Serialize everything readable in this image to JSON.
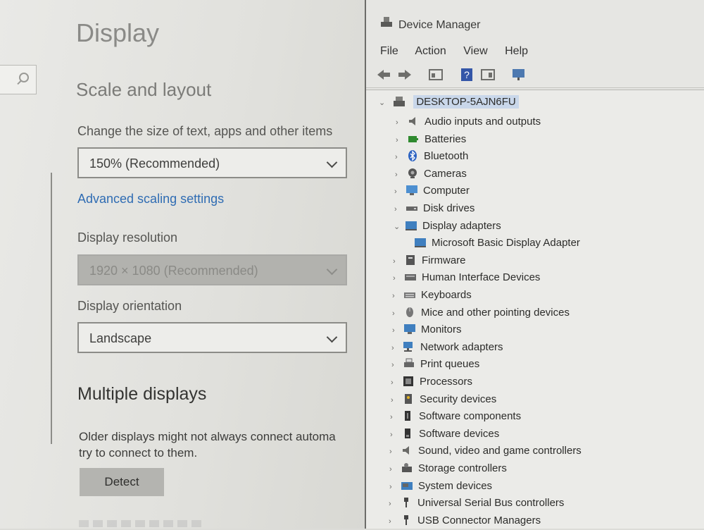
{
  "settings": {
    "title": "Display",
    "section_scale": "Scale and layout",
    "scale_label": "Change the size of text, apps and other items",
    "scale_value": "150% (Recommended)",
    "advanced_link": "Advanced scaling settings",
    "resolution_label": "Display resolution",
    "resolution_value": "1920 × 1080 (Recommended)",
    "orientation_label": "Display orientation",
    "orientation_value": "Landscape",
    "section_multiple": "Multiple displays",
    "multiple_text_1": "Older displays might not always connect automa",
    "multiple_text_2": "try to connect to them.",
    "detect_button": "Detect"
  },
  "device_manager": {
    "title": "Device Manager",
    "menu": [
      "File",
      "Action",
      "View",
      "Help"
    ],
    "root": "DESKTOP-5AJN6FU",
    "nodes": [
      {
        "label": "Audio inputs and outputs",
        "icon": "speaker-icon",
        "expanded": false
      },
      {
        "label": "Batteries",
        "icon": "battery-icon",
        "expanded": false
      },
      {
        "label": "Bluetooth",
        "icon": "bluetooth-icon",
        "expanded": false
      },
      {
        "label": "Cameras",
        "icon": "camera-icon",
        "expanded": false
      },
      {
        "label": "Computer",
        "icon": "computer-icon",
        "expanded": false
      },
      {
        "label": "Disk drives",
        "icon": "disk-icon",
        "expanded": false
      },
      {
        "label": "Display adapters",
        "icon": "display-adapter-icon",
        "expanded": true
      },
      {
        "label": "Microsoft Basic Display Adapter",
        "icon": "display-adapter-icon",
        "child": true
      },
      {
        "label": "Firmware",
        "icon": "firmware-icon",
        "expanded": false
      },
      {
        "label": "Human Interface Devices",
        "icon": "hid-icon",
        "expanded": false
      },
      {
        "label": "Keyboards",
        "icon": "keyboard-icon",
        "expanded": false
      },
      {
        "label": "Mice and other pointing devices",
        "icon": "mouse-icon",
        "expanded": false
      },
      {
        "label": "Monitors",
        "icon": "monitor-icon",
        "expanded": false
      },
      {
        "label": "Network adapters",
        "icon": "network-icon",
        "expanded": false
      },
      {
        "label": "Print queues",
        "icon": "printer-icon",
        "expanded": false
      },
      {
        "label": "Processors",
        "icon": "processor-icon",
        "expanded": false
      },
      {
        "label": "Security devices",
        "icon": "security-icon",
        "expanded": false
      },
      {
        "label": "Software components",
        "icon": "software-component-icon",
        "expanded": false
      },
      {
        "label": "Software devices",
        "icon": "software-device-icon",
        "expanded": false
      },
      {
        "label": "Sound, video and game controllers",
        "icon": "sound-icon",
        "expanded": false
      },
      {
        "label": "Storage controllers",
        "icon": "storage-icon",
        "expanded": false
      },
      {
        "label": "System devices",
        "icon": "system-icon",
        "expanded": false
      },
      {
        "label": "Universal Serial Bus controllers",
        "icon": "usb-icon",
        "expanded": false
      },
      {
        "label": "USB Connector Managers",
        "icon": "usb-icon",
        "expanded": false
      }
    ]
  },
  "colors": {
    "link": "#2f6cb3",
    "selection": "#c9d7ea"
  }
}
